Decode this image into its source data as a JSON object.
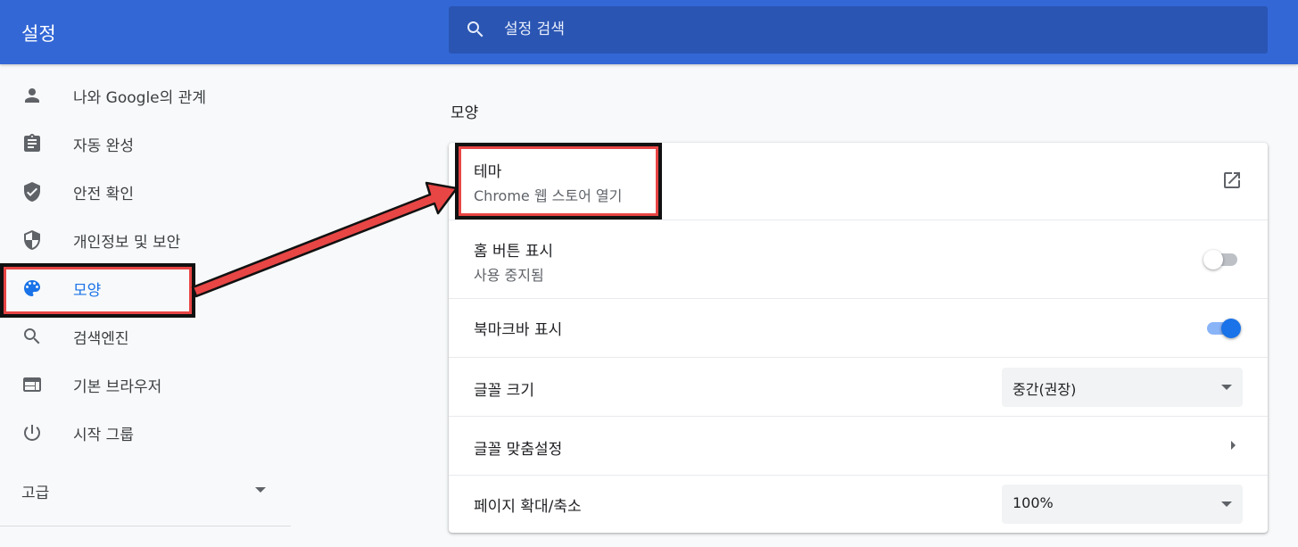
{
  "header": {
    "title": "설정",
    "search_placeholder": "설정 검색",
    "search_value": ""
  },
  "sidebar": {
    "items": [
      {
        "label": "나와 Google의 관계",
        "icon": "person-icon"
      },
      {
        "label": "자동 완성",
        "icon": "clipboard-icon"
      },
      {
        "label": "안전 확인",
        "icon": "shield-check-icon"
      },
      {
        "label": "개인정보 및 보안",
        "icon": "shield-half-icon"
      },
      {
        "label": "모양",
        "icon": "palette-icon",
        "active": true
      },
      {
        "label": "검색엔진",
        "icon": "search-icon"
      },
      {
        "label": "기본 브라우저",
        "icon": "browser-window-icon"
      },
      {
        "label": "시작 그룹",
        "icon": "power-icon"
      }
    ],
    "advanced_label": "고급"
  },
  "main": {
    "section_title": "모양",
    "rows": {
      "theme": {
        "label": "테마",
        "sublabel": "Chrome 웹 스토어 열기",
        "icon": "open-in-new-icon"
      },
      "home_button": {
        "label": "홈 버튼 표시",
        "sublabel": "사용 중지됨",
        "enabled": false
      },
      "bookmarks_bar": {
        "label": "북마크바 표시",
        "enabled": true
      },
      "font_size": {
        "label": "글꼴 크기",
        "value": "중간(권장)"
      },
      "customize_fonts": {
        "label": "글꼴 맞춤설정"
      },
      "page_zoom": {
        "label": "페이지 확대/축소",
        "value": "100%"
      }
    }
  },
  "colors": {
    "header_bg": "#3367d6",
    "search_bg": "#2a55b3",
    "accent": "#1a73e8",
    "annotation_red": "#e84545"
  }
}
